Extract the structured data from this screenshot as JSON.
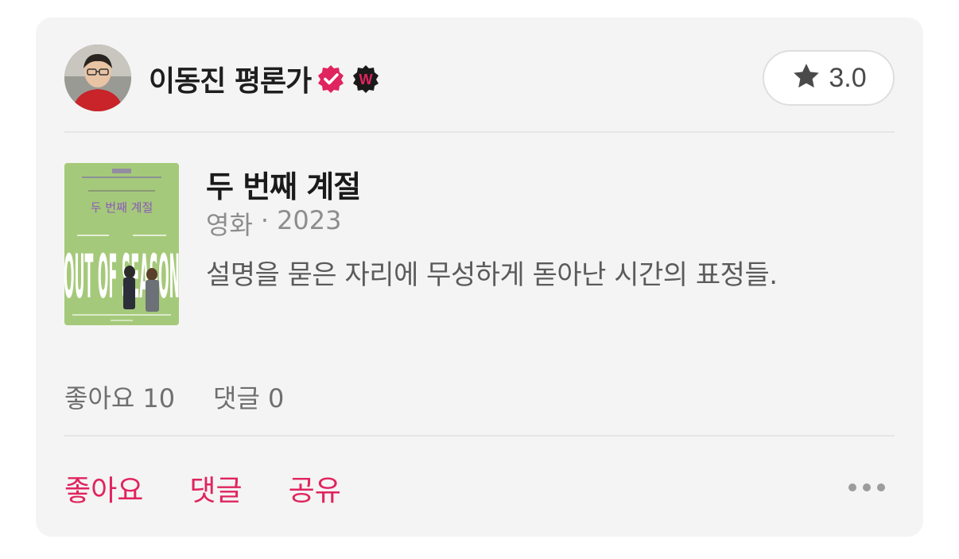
{
  "review": {
    "author": {
      "name": "이동진 평론가",
      "avatar_icon": "person-avatar",
      "verified_icon": "verified-badge-icon",
      "platform_badge_letter": "W"
    },
    "rating": {
      "icon": "star-icon",
      "value": "3.0"
    },
    "content": {
      "title": "두 번째 계절",
      "type": "영화",
      "separator": "·",
      "year": "2023",
      "text": "설명을 묻은 자리에 무성하게 돋아난 시간의 표정들.",
      "poster": {
        "title_kr": "두 번째 계절",
        "title_en": "OUT OF SEASON"
      }
    },
    "stats": {
      "likes_label": "좋아요",
      "likes_count": "10",
      "comments_label": "댓글",
      "comments_count": "0"
    },
    "actions": {
      "like": "좋아요",
      "comment": "댓글",
      "share": "공유",
      "more_icon": "more-horizontal-icon"
    }
  },
  "colors": {
    "card_background": "#f4f4f4",
    "accent": "#e0245e",
    "verified_badge": "#e0245e",
    "poster_background": "#a5c97a"
  }
}
